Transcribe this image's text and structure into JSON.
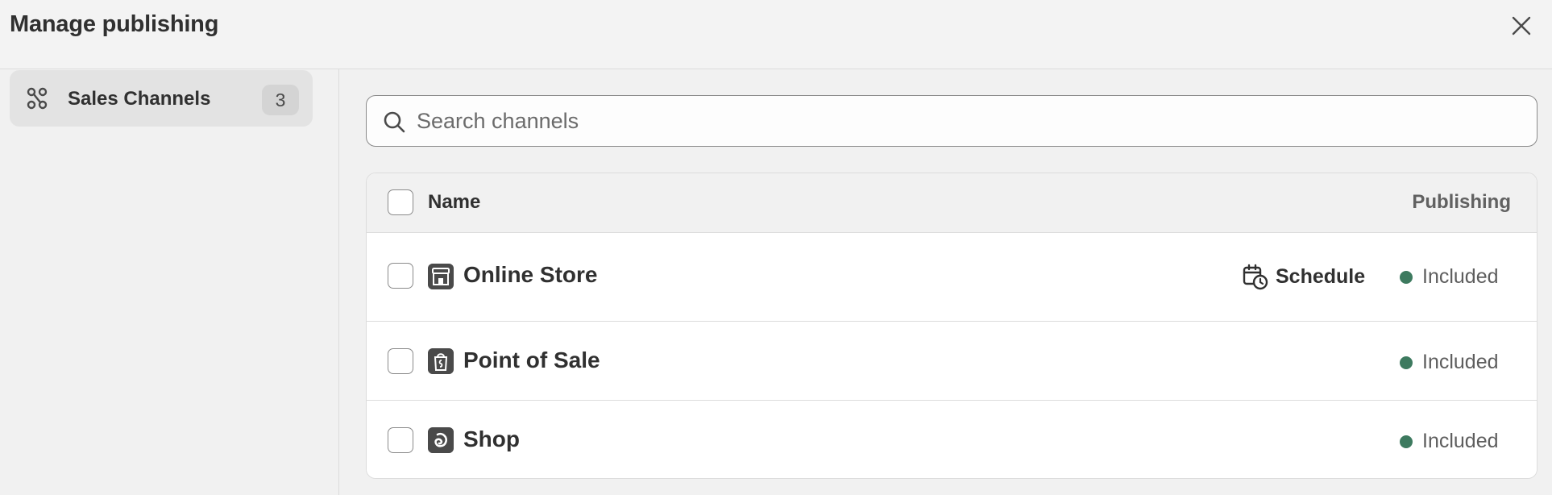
{
  "header": {
    "title": "Manage publishing",
    "close_icon": "close-icon"
  },
  "sidebar": {
    "items": [
      {
        "label": "Sales Channels",
        "count": "3",
        "icon": "sales-channels-icon"
      }
    ]
  },
  "search": {
    "placeholder": "Search channels",
    "value": "",
    "icon": "search-icon"
  },
  "table": {
    "columns": {
      "name": "Name",
      "publishing": "Publishing"
    },
    "rows": [
      {
        "name": "Online Store",
        "icon": "store-icon",
        "action": "Schedule",
        "status": "Included"
      },
      {
        "name": "Point of Sale",
        "icon": "bag-icon",
        "status": "Included"
      },
      {
        "name": "Shop",
        "icon": "shop-icon",
        "status": "Included"
      }
    ]
  },
  "colors": {
    "status_included": "#3d7a5f",
    "accent_text": "#303030"
  }
}
